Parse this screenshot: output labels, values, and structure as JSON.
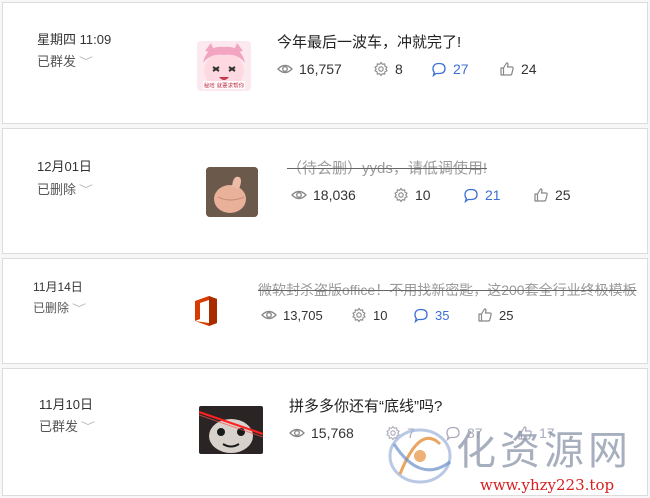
{
  "posts": [
    {
      "date": "星期四 11:09",
      "status": "已群发",
      "title": "今年最后一波车，冲就完了!",
      "deleted": false,
      "stats": {
        "views": "16,757",
        "shares": "8",
        "comments": "27",
        "likes": "24"
      },
      "thumb_text": "秘哈 就要求帮你"
    },
    {
      "date": "12月01日",
      "status": "已删除",
      "title": "（待会删）yyds，请低调使用!",
      "deleted": true,
      "stats": {
        "views": "18,036",
        "shares": "10",
        "comments": "21",
        "likes": "25"
      }
    },
    {
      "date": "11月14日",
      "status": "已删除",
      "title": "微软封杀盗版office！不用找新密匙，这200套全行业终极模板",
      "deleted": true,
      "stats": {
        "views": "13,705",
        "shares": "10",
        "comments": "35",
        "likes": "25"
      }
    },
    {
      "date": "11月10日",
      "status": "已群发",
      "title": "拼多多你还有“底线”吗?",
      "deleted": false,
      "stats": {
        "views": "15,768",
        "shares": "7",
        "comments": "37",
        "likes": "17"
      }
    }
  ],
  "watermark": {
    "brand": "化资源网",
    "url": "www.yhzy223.top"
  },
  "colors": {
    "comment_blue": "#3b6fd4",
    "border": "#dcdcdc",
    "deleted_gray": "#9a9a9a"
  }
}
